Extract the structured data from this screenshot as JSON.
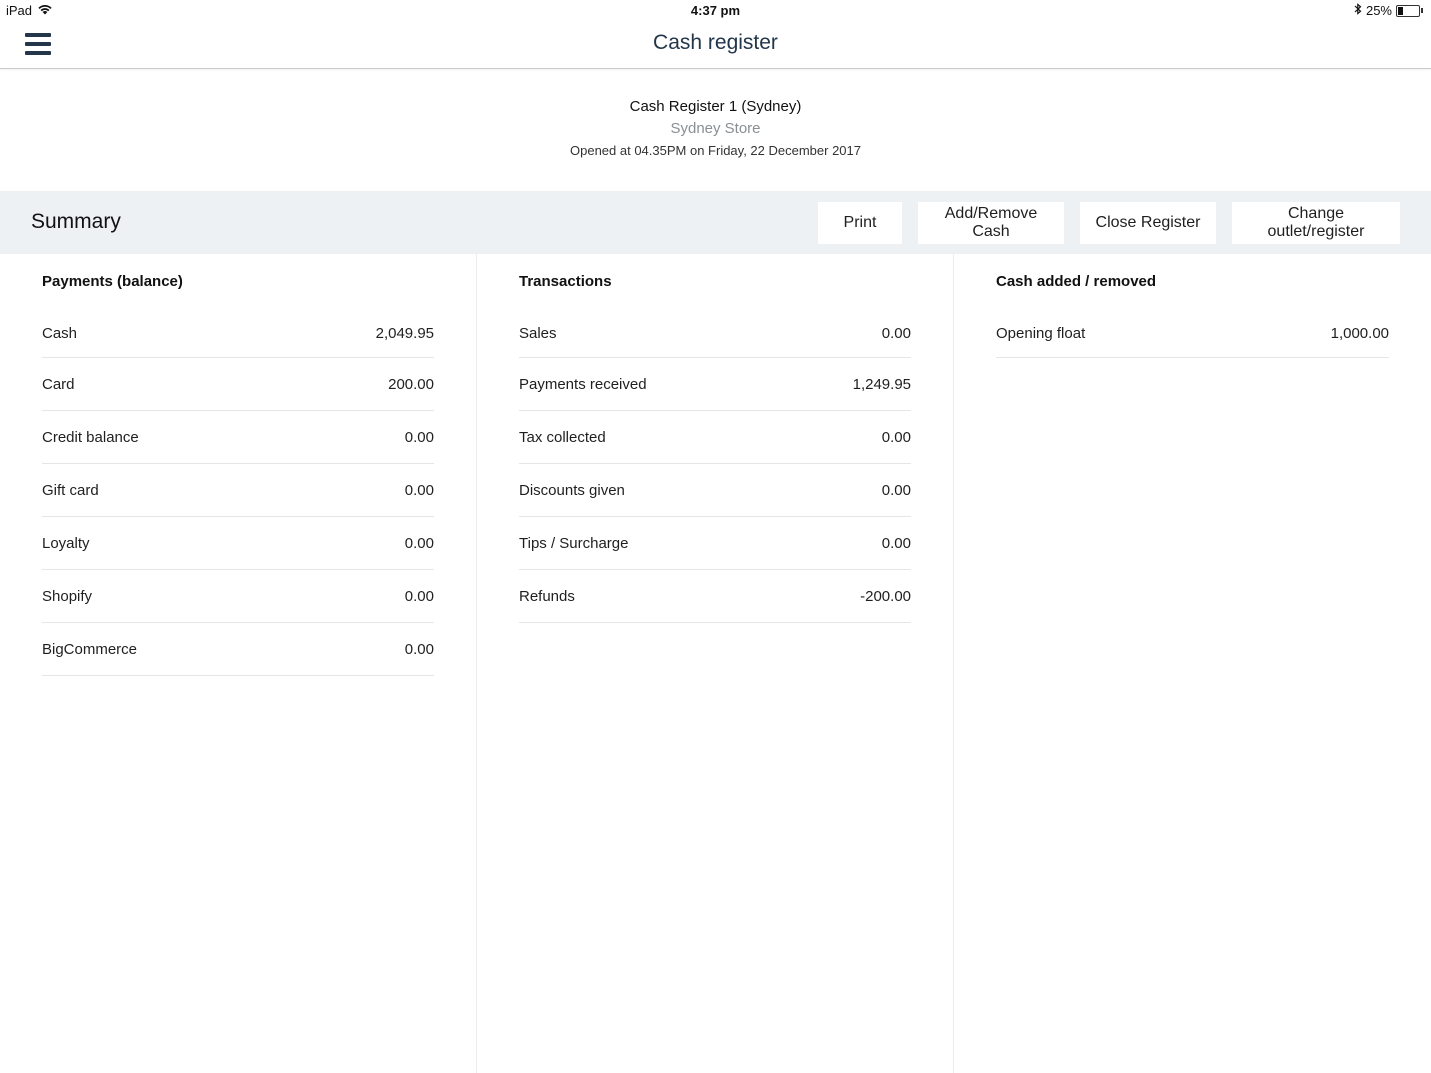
{
  "status_bar": {
    "device": "iPad",
    "time": "4:37 pm",
    "battery": "25%"
  },
  "nav": {
    "title": "Cash register"
  },
  "register": {
    "name": "Cash Register 1 (Sydney)",
    "store": "Sydney Store",
    "opened": "Opened at 04.35PM on Friday, 22 December 2017"
  },
  "summary": {
    "title": "Summary",
    "buttons": {
      "print": "Print",
      "add_remove_cash": "Add/Remove Cash",
      "close_register": "Close Register",
      "change_outlet": "Change outlet/register"
    }
  },
  "payments": {
    "heading": "Payments (balance)",
    "rows": [
      {
        "label": "Cash",
        "value": "2,049.95"
      },
      {
        "label": "Card",
        "value": "200.00"
      },
      {
        "label": "Credit balance",
        "value": "0.00"
      },
      {
        "label": "Gift card",
        "value": "0.00"
      },
      {
        "label": "Loyalty",
        "value": "0.00"
      },
      {
        "label": "Shopify",
        "value": "0.00"
      },
      {
        "label": "BigCommerce",
        "value": "0.00"
      }
    ]
  },
  "transactions": {
    "heading": "Transactions",
    "rows": [
      {
        "label": "Sales",
        "value": "0.00"
      },
      {
        "label": "Payments received",
        "value": "1,249.95"
      },
      {
        "label": "Tax collected",
        "value": "0.00"
      },
      {
        "label": "Discounts given",
        "value": "0.00"
      },
      {
        "label": "Tips / Surcharge",
        "value": "0.00"
      },
      {
        "label": "Refunds",
        "value": "-200.00"
      }
    ]
  },
  "cash_movements": {
    "heading": "Cash added / removed",
    "rows": [
      {
        "label": "Opening float",
        "value": "1,000.00"
      }
    ]
  }
}
